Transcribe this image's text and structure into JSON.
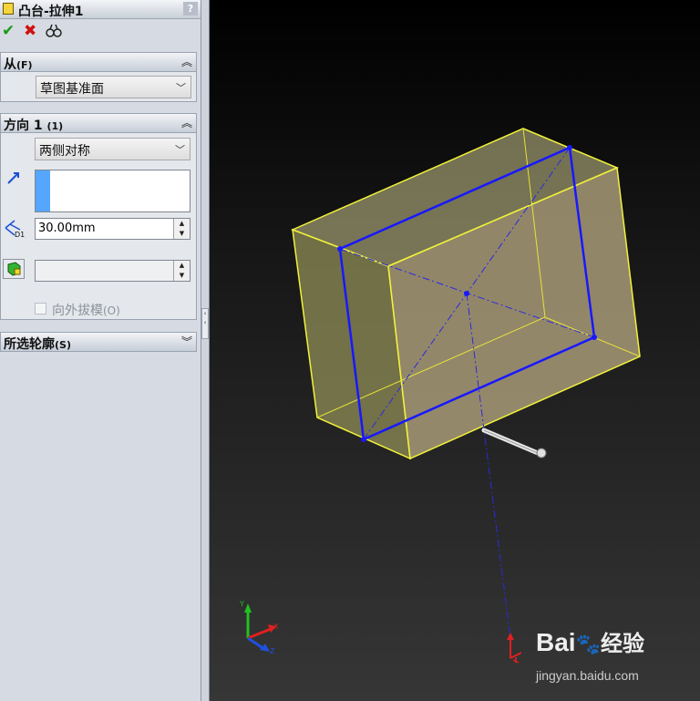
{
  "property_manager": {
    "title": "凸台-拉伸1",
    "help_label": "?",
    "actions": [
      "ok-icon",
      "cancel-icon",
      "detailed-preview-icon"
    ]
  },
  "from_section": {
    "label": "从",
    "shortcut": "(F)",
    "start_condition": "草图基准面"
  },
  "direction1_section": {
    "label": "方向 1",
    "shortcut": "(1)",
    "end_condition": "两侧对称",
    "depth": "30.00mm",
    "depth_icon_label": "D1",
    "draft_outward_label": "向外拔模",
    "draft_outward_shortcut": "(O)",
    "draft_outward_checked": false
  },
  "selected_contours_section": {
    "label": "所选轮廓",
    "shortcut": "(S)"
  },
  "colors": {
    "sketch_blue": "#1a1aff",
    "preview_yellow": "#e8e82a",
    "panel_bg": "#d6dbe3"
  },
  "watermark": {
    "brand": "Bai",
    "brand_suffix": "经验",
    "url": "jingyan.baidu.com"
  }
}
